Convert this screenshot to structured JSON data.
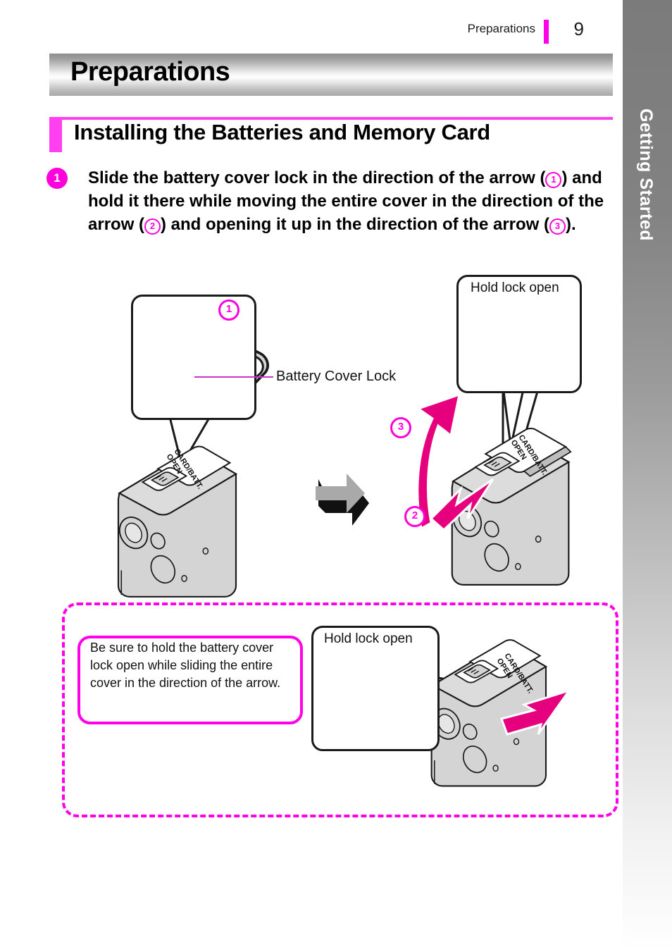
{
  "header": {
    "chapter": "Preparations",
    "page_number": "9",
    "accent_color": "#ff00e8"
  },
  "side_tab": {
    "label": "Getting Started",
    "gradient_from": "#7b7b7b",
    "gradient_to": "#ffffff"
  },
  "title_bar": {
    "title": "Preparations"
  },
  "section": {
    "heading": "Installing the Batteries and Memory Card",
    "accent_color": "#ff3ff0"
  },
  "step": {
    "number": "1",
    "text_parts": {
      "p1": "Slide the battery cover lock in the direction of the arrow (",
      "n1": "1",
      "p2": ") and hold it there while moving the entire cover in the direction of the arrow (",
      "n2": "2",
      "p3": ") and opening it up in the direction of the arrow (",
      "n3": "3",
      "p4": ")."
    }
  },
  "figure_left": {
    "callout_label": "",
    "arrow_label": "1",
    "leader_label": "Battery Cover Lock",
    "camera_cover_text_line1": "CARD/BATT.",
    "camera_cover_text_line2": "OPEN"
  },
  "figure_transition": {
    "icon": "right-arrow-icon",
    "color": "#a9a9a9"
  },
  "figure_right": {
    "callout_label": "Hold lock open",
    "arrow_label_2": "2",
    "arrow_label_3": "3",
    "camera_cover_text_line1": "CARD/BATT.",
    "camera_cover_text_line2": "OPEN"
  },
  "note": {
    "text": "Be sure to hold the battery cover lock open while sliding the entire cover in the direction of the arrow.",
    "callout_label": "Hold lock open",
    "camera_cover_text_line1": "CARD/BATT.",
    "camera_cover_text_line2": "OPEN",
    "border_color": "#ff00e8"
  }
}
